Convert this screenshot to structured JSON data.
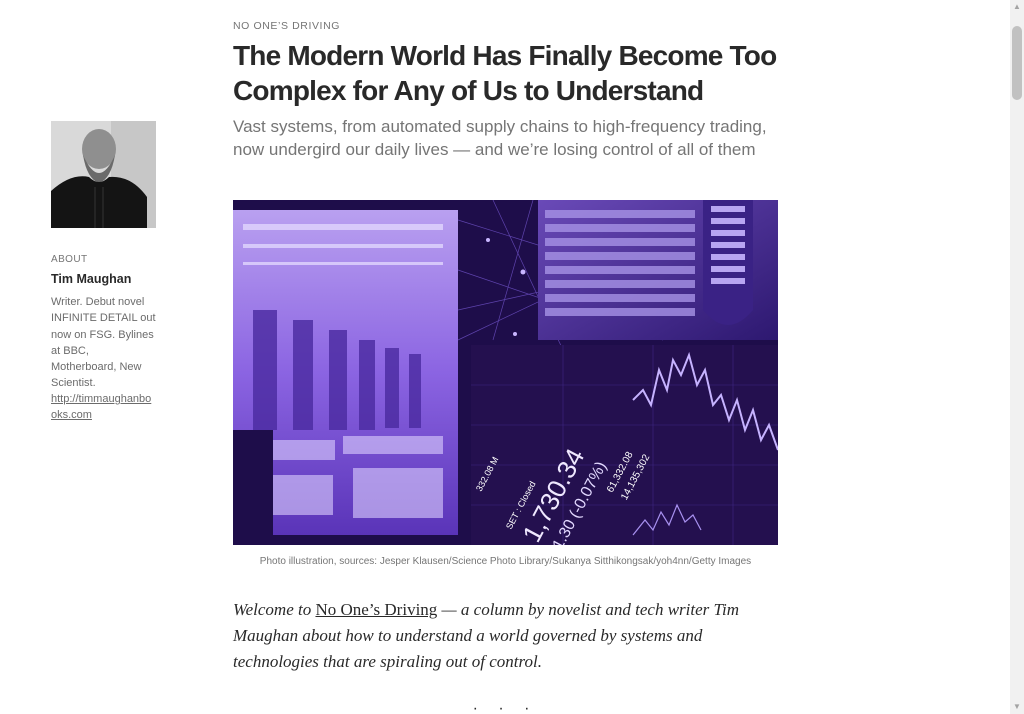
{
  "article": {
    "kicker": "NO ONE’S DRIVING",
    "headline": "The Modern World Has Finally Become Too Complex for Any of Us to Understand",
    "subtitle": "Vast systems, from automated supply chains to high-frequency trading, now undergird our daily lives — and we’re losing control of all of them",
    "caption": "Photo illustration, sources: Jesper Klausen/Science Photo Library/Sukanya Sitthikongsak/yoh4nn/Getty Images",
    "intro_prefix": "Welcome to ",
    "intro_link": "No One’s Driving",
    "intro_suffix": " — a column by novelist and tech writer Tim Maughan about how to understand a world governed by systems and technologies that are spiraling out of control.",
    "separator": "· · ·"
  },
  "hero_text": {
    "price": "1,730.34",
    "change": "-1.30 (-0.07%)",
    "set_closed": "SET : Closed",
    "volume_a": "332.08 M",
    "volume_b": "61,332.08",
    "volume_c": "14,135,302"
  },
  "author": {
    "about_label": "ABOUT",
    "name": "Tim Maughan",
    "bio": "Writer. Debut novel INFINITE DETAIL out now on FSG. Bylines at BBC, Motherboard, New Scientist.",
    "link": "http://timmaughanbooks.com"
  },
  "scrollbar": {
    "up_icon": "▲",
    "down_icon": "▼"
  },
  "colors": {
    "hero_purple": "#6a3fd6",
    "hero_dark": "#1a0b3d",
    "text": "#292929",
    "muted": "#757575"
  }
}
